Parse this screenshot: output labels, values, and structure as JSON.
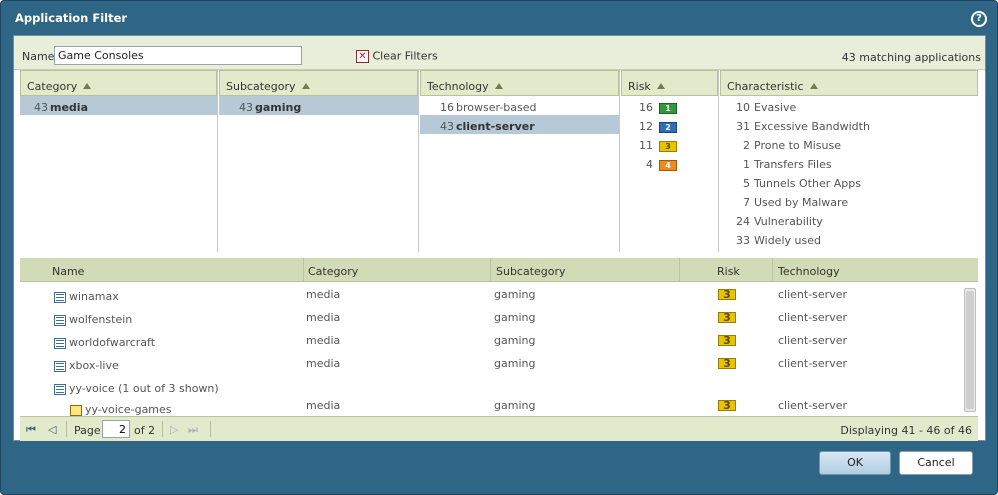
{
  "dialog": {
    "title": "Application Filter"
  },
  "filter": {
    "name_label": "Name",
    "name_value": "Game Consoles",
    "clear_label": "Clear Filters",
    "match_count": "43 matching applications"
  },
  "columns": {
    "category": {
      "header": "Category",
      "items": [
        {
          "count": "43",
          "label": "media",
          "selected": true
        }
      ]
    },
    "subcategory": {
      "header": "Subcategory",
      "items": [
        {
          "count": "43",
          "label": "gaming",
          "selected": true
        }
      ]
    },
    "technology": {
      "header": "Technology",
      "items": [
        {
          "count": "16",
          "label": "browser-based",
          "selected": false
        },
        {
          "count": "43",
          "label": "client-server",
          "selected": true
        }
      ]
    },
    "risk": {
      "header": "Risk",
      "items": [
        {
          "count": "16",
          "level": "1",
          "color": "#2e9a3a"
        },
        {
          "count": "12",
          "level": "2",
          "color": "#2f6db7"
        },
        {
          "count": "11",
          "level": "3",
          "color": "#e8c400"
        },
        {
          "count": "4",
          "level": "4",
          "color": "#ee8a1a"
        }
      ]
    },
    "characteristic": {
      "header": "Characteristic",
      "items": [
        {
          "count": "10",
          "label": "Evasive"
        },
        {
          "count": "31",
          "label": "Excessive Bandwidth"
        },
        {
          "count": "2",
          "label": "Prone to Misuse"
        },
        {
          "count": "1",
          "label": "Transfers Files"
        },
        {
          "count": "5",
          "label": "Tunnels Other Apps"
        },
        {
          "count": "7",
          "label": "Used by Malware"
        },
        {
          "count": "24",
          "label": "Vulnerability"
        },
        {
          "count": "33",
          "label": "Widely used"
        }
      ]
    }
  },
  "grid": {
    "headers": {
      "name": "Name",
      "category": "Category",
      "subcategory": "Subcategory",
      "risk": "Risk",
      "technology": "Technology"
    },
    "rows": [
      {
        "name": "winamax",
        "category": "media",
        "subcategory": "gaming",
        "risk": "3",
        "technology": "client-server"
      },
      {
        "name": "wolfenstein",
        "category": "media",
        "subcategory": "gaming",
        "risk": "3",
        "technology": "client-server"
      },
      {
        "name": "worldofwarcraft",
        "category": "media",
        "subcategory": "gaming",
        "risk": "3",
        "technology": "client-server"
      },
      {
        "name": "xbox-live",
        "category": "media",
        "subcategory": "gaming",
        "risk": "3",
        "technology": "client-server"
      },
      {
        "name": "yy-voice (1 out of 3 shown)",
        "category": "",
        "subcategory": "",
        "risk": "",
        "technology": ""
      },
      {
        "name": "yy-voice-games",
        "category": "media",
        "subcategory": "gaming",
        "risk": "3",
        "technology": "client-server"
      }
    ]
  },
  "pager": {
    "page_label": "Page",
    "page_value": "2",
    "of_label": "of 2",
    "displaying": "Displaying 41 - 46 of 46"
  },
  "buttons": {
    "ok": "OK",
    "cancel": "Cancel"
  },
  "icons": [
    "help-icon",
    "clear-filters-icon",
    "sort-ascending-icon",
    "application-icon",
    "sub-application-icon",
    "first-page-icon",
    "previous-page-icon",
    "next-page-icon",
    "last-page-icon"
  ]
}
